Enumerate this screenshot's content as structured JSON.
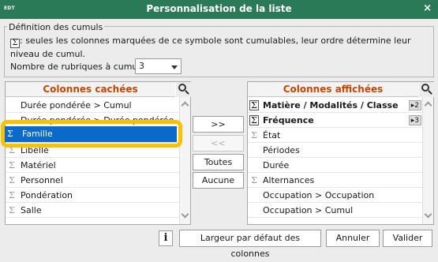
{
  "window": {
    "logo": "EDT",
    "title": "Personnalisation de la liste",
    "close_label": "×"
  },
  "cumuls": {
    "legend": "Définition des cumuls",
    "info_line1": ": seules les colonnes marquées de ce symbole sont cumulables, leur ordre détermine leur",
    "info_line2": "niveau de cumul.",
    "count_label": "Nombre de rubriques à cumuler :",
    "count_value": "3"
  },
  "hidden_columns": {
    "header": "Colonnes cachées",
    "selected": "Famille",
    "items": [
      {
        "label": "Durée pondérée > Cumul",
        "sigma": false
      },
      {
        "label": "Durée pondérée > Durée pondérée",
        "sigma": false
      },
      {
        "label": "Famille",
        "sigma": true
      },
      {
        "label": "Libellé",
        "sigma": true
      },
      {
        "label": "Matériel",
        "sigma": true
      },
      {
        "label": "Personnel",
        "sigma": true
      },
      {
        "label": "Pondération",
        "sigma": true
      },
      {
        "label": "Salle",
        "sigma": true
      }
    ]
  },
  "transfer": {
    "add": ">>",
    "remove": "<<",
    "all": "Toutes",
    "none": "Aucune"
  },
  "shown_columns": {
    "header": "Colonnes affichées",
    "items": [
      {
        "label": "Matière / Modalités / Classe",
        "sigma": "active",
        "badge": "▸2",
        "bold": true
      },
      {
        "label": "Fréquence",
        "sigma": "active",
        "badge": "▸3",
        "bold": true
      },
      {
        "label": "État",
        "sigma": "grey",
        "badge": "",
        "bold": false
      },
      {
        "label": "Périodes",
        "sigma": "none",
        "badge": "",
        "bold": false
      },
      {
        "label": "Durée",
        "sigma": "none",
        "badge": "",
        "bold": false
      },
      {
        "label": "Alternances",
        "sigma": "grey",
        "badge": "",
        "bold": false
      },
      {
        "label": "Occupation > Occupation",
        "sigma": "none",
        "badge": "",
        "bold": false
      },
      {
        "label": "Occupation > Cumul",
        "sigma": "none",
        "badge": "",
        "bold": false
      }
    ]
  },
  "footer": {
    "info_glyph": "i",
    "default_width": "Largeur par défaut des colonnes",
    "cancel": "Annuler",
    "validate": "Valider"
  },
  "sigma_glyph": "Σ"
}
